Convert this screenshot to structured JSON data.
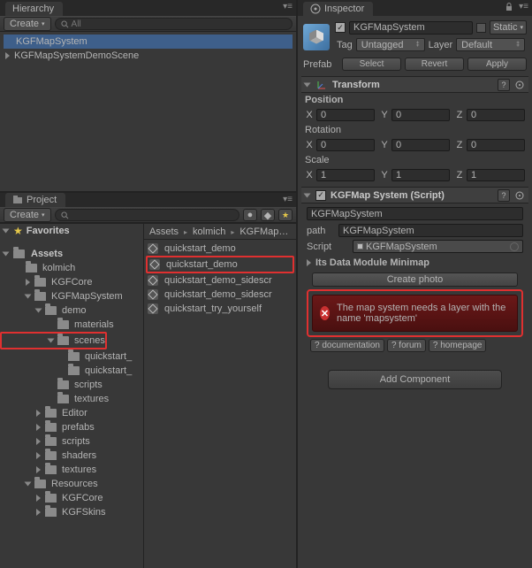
{
  "hierarchy": {
    "tab": "Hierarchy",
    "create": "Create",
    "search_placeholder": "All",
    "items": [
      "KGFMapSystem",
      "KGFMapSystemDemoScene"
    ],
    "selected_index": 0
  },
  "project": {
    "tab": "Project",
    "create": "Create",
    "favorites": "Favorites",
    "assets_label": "Assets",
    "tree": [
      {
        "label": "kolmich",
        "depth": 1,
        "open": true
      },
      {
        "label": "KGFCore",
        "depth": 2,
        "open": false,
        "fold": true
      },
      {
        "label": "KGFMapSystem",
        "depth": 2,
        "open": true,
        "fold": true
      },
      {
        "label": "demo",
        "depth": 3,
        "open": true,
        "fold": true
      },
      {
        "label": "materials",
        "depth": 4
      },
      {
        "label": "scenes",
        "depth": 4,
        "open": true,
        "fold": true,
        "hl": true
      },
      {
        "label": "quickstart_",
        "depth": 5
      },
      {
        "label": "quickstart_",
        "depth": 5
      },
      {
        "label": "scripts",
        "depth": 4
      },
      {
        "label": "textures",
        "depth": 4
      },
      {
        "label": "Editor",
        "depth": 3,
        "fold": true
      },
      {
        "label": "prefabs",
        "depth": 3,
        "fold": true
      },
      {
        "label": "scripts",
        "depth": 3,
        "fold": true
      },
      {
        "label": "shaders",
        "depth": 3,
        "fold": true
      },
      {
        "label": "textures",
        "depth": 3,
        "fold": true
      },
      {
        "label": "Resources",
        "depth": 2,
        "open": true,
        "fold": true
      },
      {
        "label": "KGFCore",
        "depth": 3,
        "fold": true
      },
      {
        "label": "KGFSkins",
        "depth": 3,
        "fold": true
      }
    ],
    "breadcrumb": [
      "Assets",
      "kolmich",
      "KGFMap…"
    ],
    "files": [
      {
        "label": "quickstart_demo",
        "type": "unity"
      },
      {
        "label": "quickstart_demo",
        "type": "unity",
        "hl": true
      },
      {
        "label": "quickstart_demo_sidescr",
        "type": "unity"
      },
      {
        "label": "quickstart_demo_sidescr",
        "type": "unity"
      },
      {
        "label": "quickstart_try_yourself",
        "type": "unity"
      }
    ]
  },
  "inspector": {
    "tab": "Inspector",
    "go_name": "KGFMapSystem",
    "static": "Static",
    "tag_label": "Tag",
    "tag_value": "Untagged",
    "layer_label": "Layer",
    "layer_value": "Default",
    "prefab_label": "Prefab",
    "prefab_btns": [
      "Select",
      "Revert",
      "Apply"
    ],
    "transform": {
      "title": "Transform",
      "position": "Position",
      "rotation": "Rotation",
      "scale": "Scale",
      "pos": {
        "x": "0",
        "y": "0",
        "z": "0"
      },
      "rot": {
        "x": "0",
        "y": "0",
        "z": "0"
      },
      "scl": {
        "x": "1",
        "y": "1",
        "z": "1"
      }
    },
    "kgf": {
      "title": "KGFMap System (Script)",
      "name_field": "KGFMapSystem",
      "path_label": "path",
      "path_value": "KGFMapSystem",
      "script_label": "Script",
      "script_value": "KGFMapSystem",
      "its_label": "Its Data Module Minimap",
      "create_photo": "Create photo",
      "error": "The map system needs a layer with the name 'mapsystem'",
      "help_btns": [
        "? documentation",
        "? forum",
        "? homepage"
      ]
    },
    "add_component": "Add Component"
  }
}
